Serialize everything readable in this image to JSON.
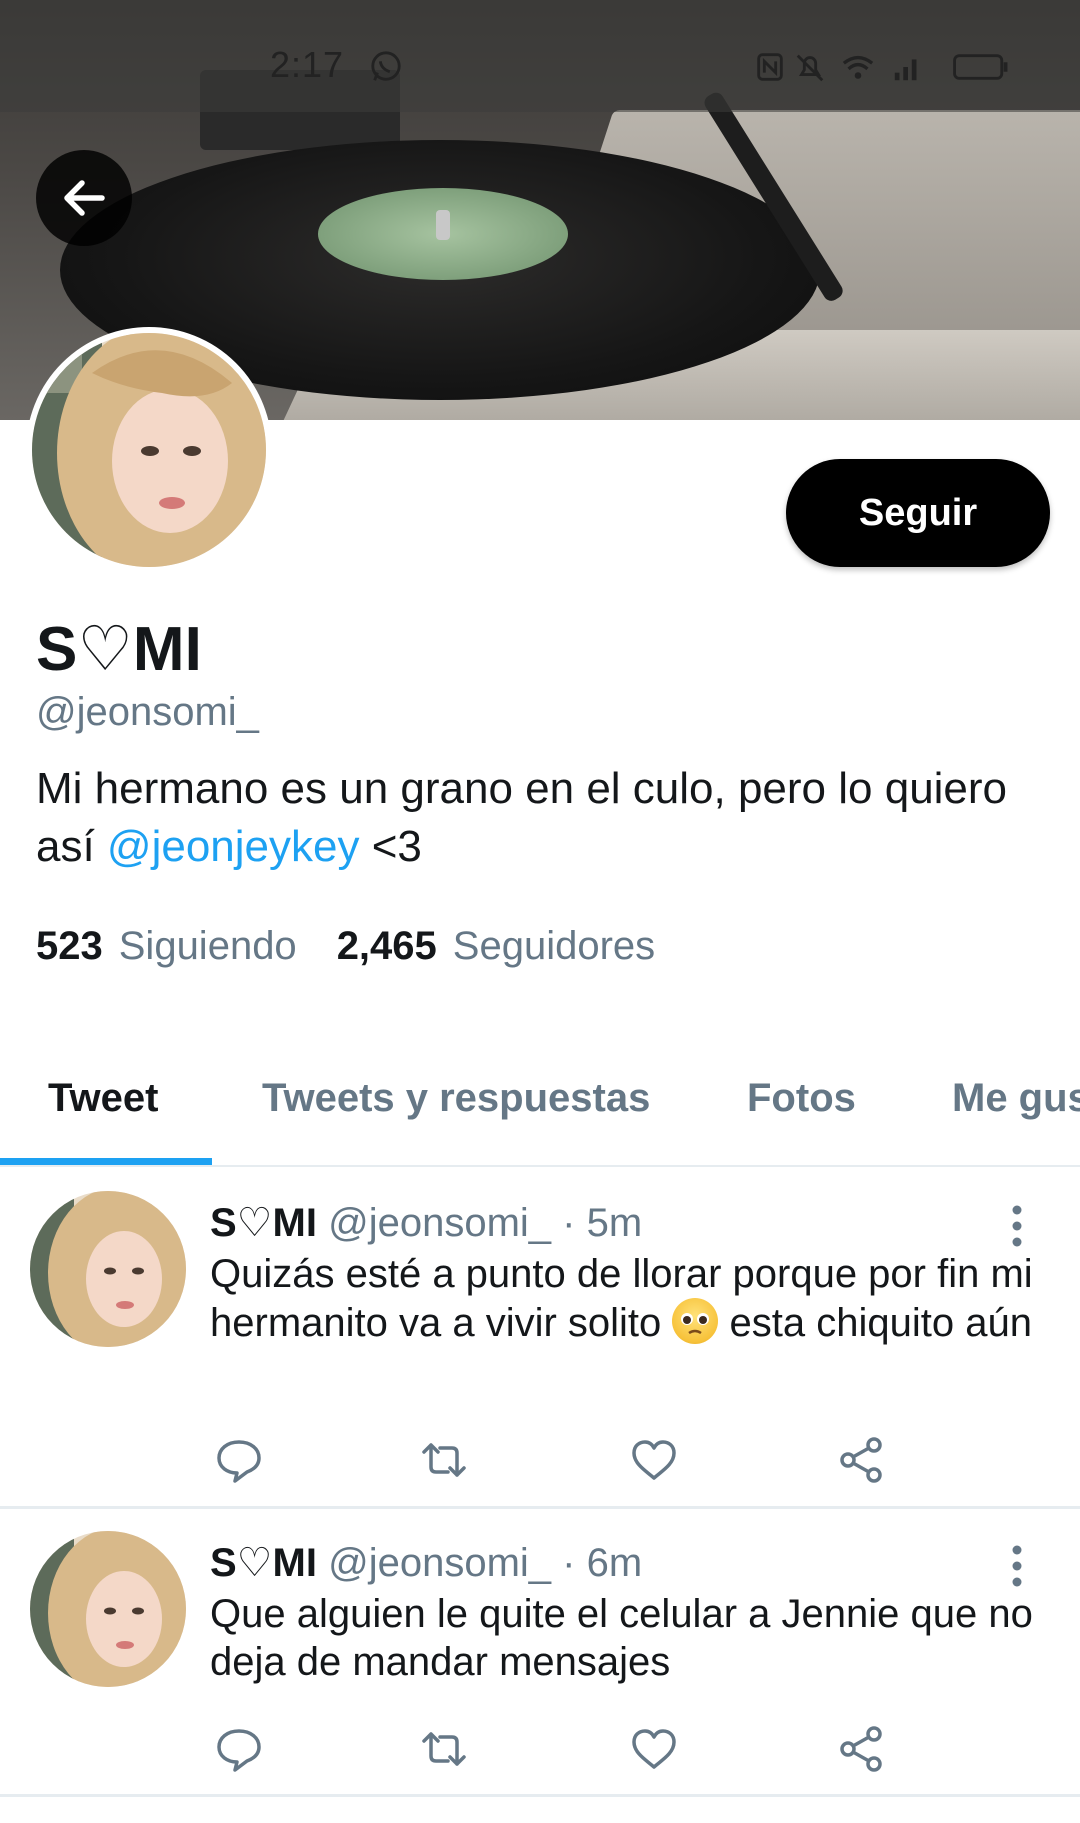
{
  "status_bar": {
    "time": "2:17",
    "icons": [
      "whatsapp-icon",
      "nfc-icon",
      "mute-bell-icon",
      "wifi-icon",
      "signal-icon",
      "battery-icon"
    ]
  },
  "profile": {
    "display_name": "S♡MI",
    "handle": "@jeonsomi_",
    "bio_text": "Mi hermano es un grano en el culo, pero lo quiero así ",
    "bio_mention": "@jeonjeykey",
    "bio_suffix": " <3",
    "following_count": "523",
    "following_label": "Siguiendo",
    "followers_count": "2,465",
    "followers_label": "Seguidores",
    "follow_button": "Seguir"
  },
  "tabs": [
    {
      "label": "Tweet",
      "active": true
    },
    {
      "label": "Tweets y respuestas",
      "active": false
    },
    {
      "label": "Fotos",
      "active": false
    },
    {
      "label": "Me gus",
      "active": false
    }
  ],
  "tweets": [
    {
      "name": "S♡MI",
      "handle": "@jeonsomi_",
      "time": "5m",
      "text_before_emoji": "Quizás esté a punto de llorar porque por fin mi hermanito va a vivir solito ",
      "emoji": "pleading-face-emoji",
      "text_after_emoji": " esta chiquito aún"
    },
    {
      "name": "S♡MI",
      "handle": "@jeonsomi_",
      "time": "6m",
      "text": "Que alguien le quite el celular a Jennie que no deja de mandar mensajes"
    }
  ],
  "colors": {
    "accent": "#1da1f2",
    "secondary_text": "#657786",
    "primary_text": "#14171a",
    "follow_button_bg": "#000000"
  }
}
